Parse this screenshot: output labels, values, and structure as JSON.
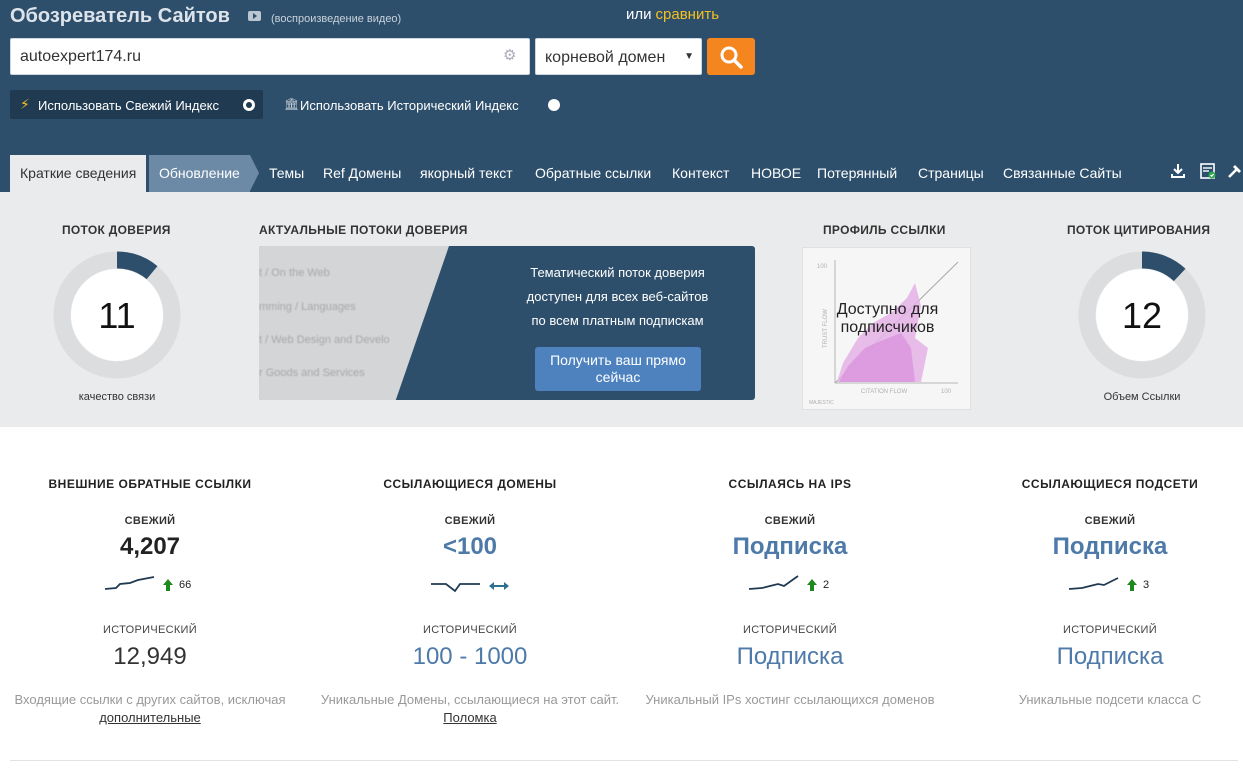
{
  "header": {
    "title": "Обозреватель Сайтов",
    "video_link": "(воспроизведение видео)",
    "or_text": "или",
    "compare_link": "сравнить"
  },
  "search": {
    "value": "autoexpert174.ru",
    "scope_selected": "корневой домен"
  },
  "index_options": {
    "fresh": "Использовать Свежий Индекс",
    "historic": "Использовать Исторический Индекс"
  },
  "tabs": [
    "Краткие сведения",
    "Обновление",
    "Темы",
    "Ref Домены",
    "якорный текст",
    "Обратные ссылки",
    "Контекст",
    "НОВОЕ",
    "Потерянный",
    "Страницы",
    "Связанные Сайты"
  ],
  "summary": {
    "trust_flow": {
      "title": "ПОТОК ДОВЕРИЯ",
      "value": "11",
      "caption": "качество связи",
      "fraction": 0.11
    },
    "topical": {
      "title": "АКТУАЛЬНЫЕ ПОТОКИ ДОВЕРИЯ",
      "ghost_lines": [
        "t / On the Web",
        "mming / Languages",
        "t / Web Design and Develo",
        "r Goods and Services"
      ],
      "message": [
        "Тематический поток доверия",
        "доступен для всех веб-сайтов",
        "по всем платным подпискам"
      ],
      "button": "Получить ваш прямо сейчас"
    },
    "link_profile": {
      "title": "ПРОФИЛЬ ССЫЛКИ",
      "overlay": "Доступно для подписчиков",
      "ylabel": "TRUST FLOW",
      "xlabel": "CITATION FLOW",
      "max_label": "100",
      "brand": "MAJESTIC"
    },
    "citation_flow": {
      "title": "ПОТОК ЦИТИРОВАНИЯ",
      "value": "12",
      "caption": "Объем Ссылки",
      "fraction": 0.12
    }
  },
  "metrics": [
    {
      "title": "ВНЕШНИЕ ОБРАТНЫЕ ССЫЛКИ",
      "fresh_label": "СВЕЖИЙ",
      "fresh_value": "4,207",
      "delta": "66",
      "trend": "up",
      "hist_label": "ИСТОРИЧЕСКИЙ",
      "hist_value": "12,949",
      "desc": "Входящие ссылки с других сайтов, исключая",
      "desc_link": "дополнительные"
    },
    {
      "title": "ССЫЛАЮЩИЕСЯ ДОМЕНЫ",
      "fresh_label": "СВЕЖИЙ",
      "fresh_value": "<100",
      "delta": "",
      "trend": "flat",
      "hist_label": "ИСТОРИЧЕСКИЙ",
      "hist_value": "100 - 1000",
      "desc": "Уникальные Домены, ссылающиеся на этот сайт.",
      "desc_link": "Поломка"
    },
    {
      "title": "ССЫЛАЯСЬ НА IPS",
      "fresh_label": "СВЕЖИЙ",
      "fresh_value": "Подписка",
      "delta": "2",
      "trend": "up",
      "hist_label": "ИСТОРИЧЕСКИЙ",
      "hist_value": "Подписка",
      "desc": "Уникальный IPs хостинг ссылающихся доменов",
      "desc_link": ""
    },
    {
      "title": "ССЫЛАЮЩИЕСЯ ПОДСЕТИ",
      "fresh_label": "СВЕЖИЙ",
      "fresh_value": "Подписка",
      "delta": "3",
      "trend": "up",
      "hist_label": "ИСТОРИЧЕСКИЙ",
      "hist_value": "Подписка",
      "desc": "Уникальные подсети класса С",
      "desc_link": ""
    }
  ],
  "colors": {
    "header_bg": "#2e4f6b",
    "accent_orange": "#f5861f",
    "accent_yellow": "#f5c020",
    "link_blue": "#4d7aa8",
    "up_green": "#1e8a1e"
  }
}
